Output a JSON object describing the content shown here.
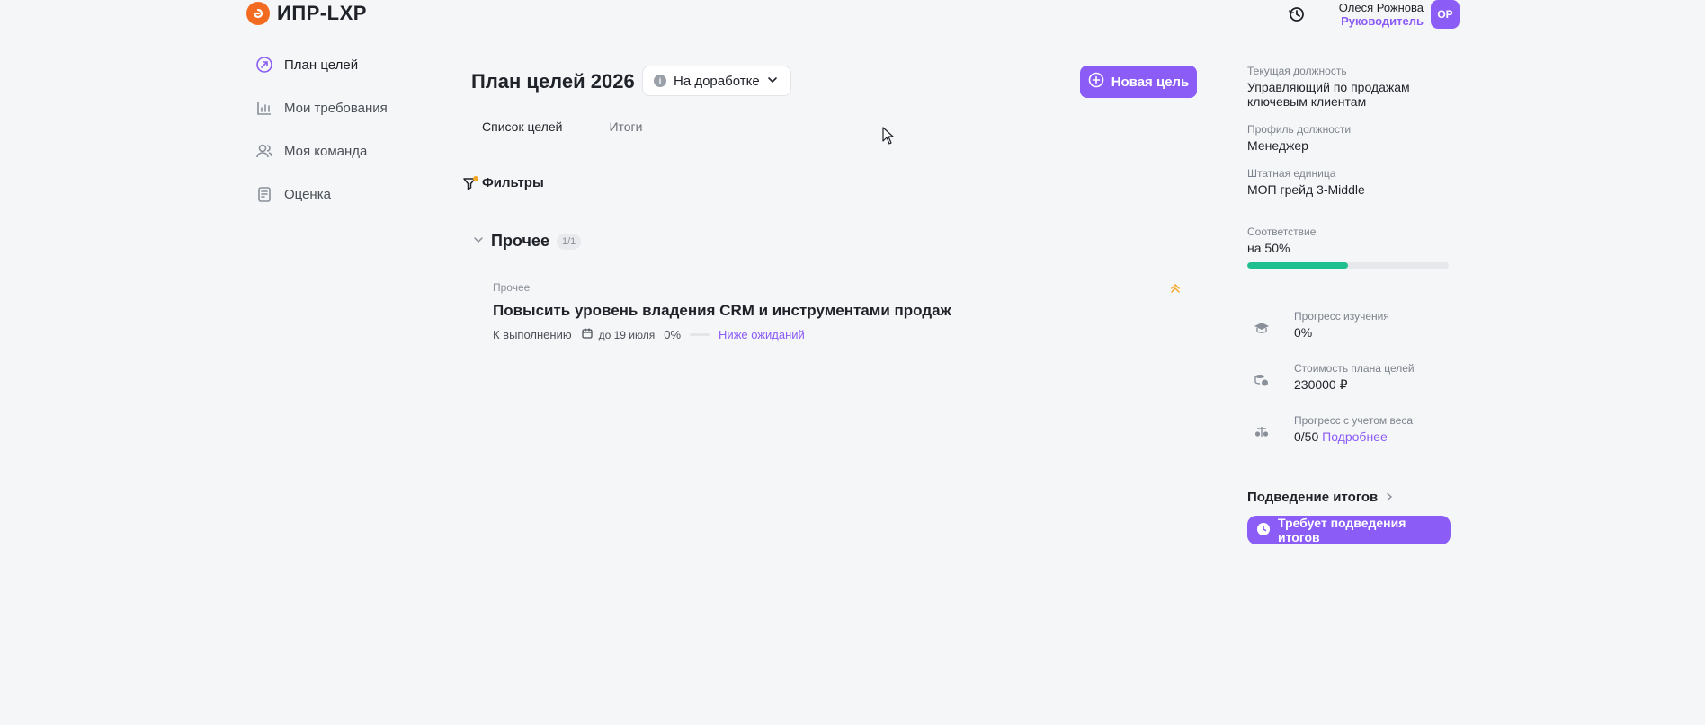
{
  "app": {
    "title": "ИПР-LXP"
  },
  "user": {
    "name": "Олеся Рожнова",
    "role": "Руководитель",
    "initials": "ОР"
  },
  "nav": {
    "items": [
      {
        "label": "План целей",
        "icon": "target-arrow-icon"
      },
      {
        "label": "Мои требования",
        "icon": "bar-chart-icon"
      },
      {
        "label": "Моя команда",
        "icon": "users-icon"
      },
      {
        "label": "Оценка",
        "icon": "clipboard-icon"
      }
    ]
  },
  "page": {
    "title": "План целей 2026",
    "status": "На доработке",
    "new_goal_label": "Новая цель",
    "tabs": [
      "Список целей",
      "Итоги"
    ],
    "filters_label": "Фильтры"
  },
  "group": {
    "name": "Прочее",
    "count": "1/1",
    "goal": {
      "category": "Прочее",
      "title": "Повысить уровень владения CRM и инструментами продаж",
      "status": "К выполнению",
      "deadline": "до 19 июля",
      "progress": "0%",
      "progress_value": 0,
      "assessment": "Ниже ожиданий"
    }
  },
  "profile": {
    "position_label": "Текущая должность",
    "position_value": "Управляющий по продажам ключевым клиентам",
    "job_profile_label": "Профиль должности",
    "job_profile_value": "Менеджер",
    "staff_unit_label": "Штатная единица",
    "staff_unit_value": "МОП грейд 3-Middle",
    "compliance_label": "Соответствие",
    "compliance_value": "на 50%",
    "compliance_fraction": 0.5
  },
  "stats": {
    "study_label": "Прогресс изучения",
    "study_value": "0%",
    "cost_label": "Стоимость плана целей",
    "cost_value": "230000 ₽",
    "weighted_label": "Прогресс с учетом веса",
    "weighted_value": "0/50",
    "weighted_link": "Подробнее"
  },
  "summary": {
    "title": "Подведение итогов",
    "badge": "Требует подведения итогов"
  },
  "colors": {
    "accent": "#8b5cf6",
    "progress": "#1fbf8f",
    "logo": "#f36b21",
    "priority": "#f5a623"
  }
}
